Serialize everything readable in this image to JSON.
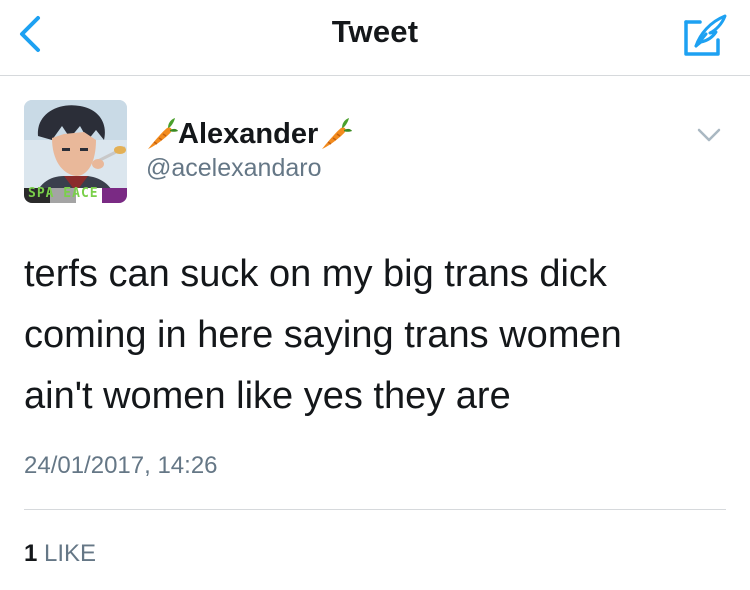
{
  "nav": {
    "title": "Tweet",
    "back_icon": "chevron-left-icon",
    "compose_icon": "compose-quill-icon",
    "accent_color": "#1da1f2"
  },
  "tweet": {
    "display_name": "Alexander",
    "name_emoji": "carrot",
    "handle": "@acelexandaro",
    "avatar_text": "SPA EACE",
    "lines": [
      "terfs can suck on my big trans dick",
      "coming in here saying trans women",
      "ain't women like yes they are"
    ],
    "timestamp": "24/01/2017, 14:26",
    "likes_count": "1",
    "likes_label": "LIKE"
  }
}
